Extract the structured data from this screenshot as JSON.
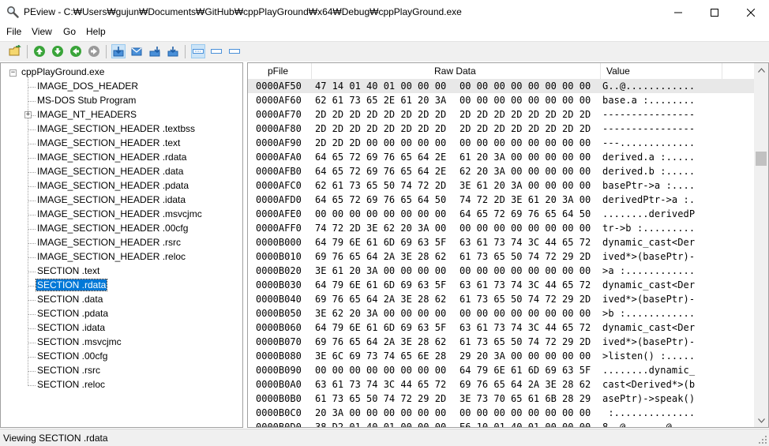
{
  "window": {
    "title": "PEview - C:₩Users₩gujun₩Documents₩GitHub₩cppPlayGround₩x64₩Debug₩cppPlayGround.exe",
    "icon": "magnifier-icon"
  },
  "menu": [
    "File",
    "View",
    "Go",
    "Help"
  ],
  "toolbar": {
    "buttons": [
      "open-file-icon",
      "back-icon",
      "forward-icon",
      "previous-icon",
      "next-icon",
      "byte-view-icon",
      "word-view-icon",
      "dword-view-icon",
      "qword-view-icon",
      "hex-view-icon",
      "address-view-icon",
      "value-view-icon"
    ]
  },
  "tree": {
    "root": "cppPlayGround.exe",
    "items": [
      "IMAGE_DOS_HEADER",
      "MS-DOS Stub Program",
      "IMAGE_NT_HEADERS",
      "IMAGE_SECTION_HEADER .textbss",
      "IMAGE_SECTION_HEADER .text",
      "IMAGE_SECTION_HEADER .rdata",
      "IMAGE_SECTION_HEADER .data",
      "IMAGE_SECTION_HEADER .pdata",
      "IMAGE_SECTION_HEADER .idata",
      "IMAGE_SECTION_HEADER .msvcjmc",
      "IMAGE_SECTION_HEADER .00cfg",
      "IMAGE_SECTION_HEADER .rsrc",
      "IMAGE_SECTION_HEADER .reloc",
      "SECTION .text",
      "SECTION .rdata",
      "SECTION .data",
      "SECTION .pdata",
      "SECTION .idata",
      "SECTION .msvcjmc",
      "SECTION .00cfg",
      "SECTION .rsrc",
      "SECTION .reloc"
    ],
    "selected": "SECTION .rdata"
  },
  "hex": {
    "columns": [
      "pFile",
      "Raw Data",
      "Value"
    ],
    "rows": [
      {
        "addr": "0000AF50",
        "raw1": "47 14 01 40 01 00 00 00",
        "raw2": "00 00 00 00 00 00 00 00",
        "value": "G..@............"
      },
      {
        "addr": "0000AF60",
        "raw1": "62 61 73 65 2E 61 20 3A",
        "raw2": "00 00 00 00 00 00 00 00",
        "value": "base.a :........"
      },
      {
        "addr": "0000AF70",
        "raw1": "2D 2D 2D 2D 2D 2D 2D 2D",
        "raw2": "2D 2D 2D 2D 2D 2D 2D 2D",
        "value": "----------------"
      },
      {
        "addr": "0000AF80",
        "raw1": "2D 2D 2D 2D 2D 2D 2D 2D",
        "raw2": "2D 2D 2D 2D 2D 2D 2D 2D",
        "value": "----------------"
      },
      {
        "addr": "0000AF90",
        "raw1": "2D 2D 2D 00 00 00 00 00",
        "raw2": "00 00 00 00 00 00 00 00",
        "value": "---............."
      },
      {
        "addr": "0000AFA0",
        "raw1": "64 65 72 69 76 65 64 2E",
        "raw2": "61 20 3A 00 00 00 00 00",
        "value": "derived.a :....."
      },
      {
        "addr": "0000AFB0",
        "raw1": "64 65 72 69 76 65 64 2E",
        "raw2": "62 20 3A 00 00 00 00 00",
        "value": "derived.b :....."
      },
      {
        "addr": "0000AFC0",
        "raw1": "62 61 73 65 50 74 72 2D",
        "raw2": "3E 61 20 3A 00 00 00 00",
        "value": "basePtr->a :...."
      },
      {
        "addr": "0000AFD0",
        "raw1": "64 65 72 69 76 65 64 50",
        "raw2": "74 72 2D 3E 61 20 3A 00",
        "value": "derivedPtr->a :."
      },
      {
        "addr": "0000AFE0",
        "raw1": "00 00 00 00 00 00 00 00",
        "raw2": "64 65 72 69 76 65 64 50",
        "value": "........derivedP"
      },
      {
        "addr": "0000AFF0",
        "raw1": "74 72 2D 3E 62 20 3A 00",
        "raw2": "00 00 00 00 00 00 00 00",
        "value": "tr->b :........."
      },
      {
        "addr": "0000B000",
        "raw1": "64 79 6E 61 6D 69 63 5F",
        "raw2": "63 61 73 74 3C 44 65 72",
        "value": "dynamic_cast<Der"
      },
      {
        "addr": "0000B010",
        "raw1": "69 76 65 64 2A 3E 28 62",
        "raw2": "61 73 65 50 74 72 29 2D",
        "value": "ived*>(basePtr)-"
      },
      {
        "addr": "0000B020",
        "raw1": "3E 61 20 3A 00 00 00 00",
        "raw2": "00 00 00 00 00 00 00 00",
        "value": ">a :............"
      },
      {
        "addr": "0000B030",
        "raw1": "64 79 6E 61 6D 69 63 5F",
        "raw2": "63 61 73 74 3C 44 65 72",
        "value": "dynamic_cast<Der"
      },
      {
        "addr": "0000B040",
        "raw1": "69 76 65 64 2A 3E 28 62",
        "raw2": "61 73 65 50 74 72 29 2D",
        "value": "ived*>(basePtr)-"
      },
      {
        "addr": "0000B050",
        "raw1": "3E 62 20 3A 00 00 00 00",
        "raw2": "00 00 00 00 00 00 00 00",
        "value": ">b :............"
      },
      {
        "addr": "0000B060",
        "raw1": "64 79 6E 61 6D 69 63 5F",
        "raw2": "63 61 73 74 3C 44 65 72",
        "value": "dynamic_cast<Der"
      },
      {
        "addr": "0000B070",
        "raw1": "69 76 65 64 2A 3E 28 62",
        "raw2": "61 73 65 50 74 72 29 2D",
        "value": "ived*>(basePtr)-"
      },
      {
        "addr": "0000B080",
        "raw1": "3E 6C 69 73 74 65 6E 28",
        "raw2": "29 20 3A 00 00 00 00 00",
        "value": ">listen() :....."
      },
      {
        "addr": "0000B090",
        "raw1": "00 00 00 00 00 00 00 00",
        "raw2": "64 79 6E 61 6D 69 63 5F",
        "value": "........dynamic_"
      },
      {
        "addr": "0000B0A0",
        "raw1": "63 61 73 74 3C 44 65 72",
        "raw2": "69 76 65 64 2A 3E 28 62",
        "value": "cast<Derived*>(b"
      },
      {
        "addr": "0000B0B0",
        "raw1": "61 73 65 50 74 72 29 2D",
        "raw2": "3E 73 70 65 61 6B 28 29",
        "value": "asePtr)->speak()"
      },
      {
        "addr": "0000B0C0",
        "raw1": "20 3A 00 00 00 00 00 00",
        "raw2": "00 00 00 00 00 00 00 00",
        "value": " :.............."
      },
      {
        "addr": "0000B0D0",
        "raw1": "38 D2 01 40 01 00 00 00",
        "raw2": "E6 10 01 40 01 00 00 00",
        "value": "8..@.......@...."
      }
    ]
  },
  "status": "Viewing SECTION .rdata"
}
